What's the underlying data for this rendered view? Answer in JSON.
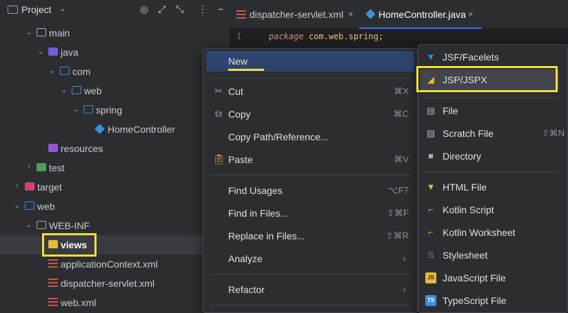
{
  "project_panel": {
    "title": "Project",
    "tree": [
      {
        "label": "main",
        "icon": "folder-icon"
      },
      {
        "label": "java",
        "icon": "source-folder-icon"
      },
      {
        "label": "com",
        "icon": "package-icon"
      },
      {
        "label": "web",
        "icon": "package-icon"
      },
      {
        "label": "spring",
        "icon": "package-icon"
      },
      {
        "label": "HomeController",
        "icon": "java-class-icon"
      },
      {
        "label": "resources",
        "icon": "resources-folder-icon"
      },
      {
        "label": "test",
        "icon": "test-folder-icon"
      },
      {
        "label": "target",
        "icon": "excluded-folder-icon"
      },
      {
        "label": "web",
        "icon": "web-folder-icon"
      },
      {
        "label": "WEB-INF",
        "icon": "folder-icon"
      },
      {
        "label": "views",
        "icon": "folder-icon"
      },
      {
        "label": "applicationContext.xml",
        "icon": "xml-file-icon"
      },
      {
        "label": "dispatcher-servlet.xml",
        "icon": "xml-file-icon"
      },
      {
        "label": "web.xml",
        "icon": "xml-file-icon"
      }
    ]
  },
  "tabs": [
    {
      "label": "dispatcher-servlet.xml",
      "icon": "xml-file-icon"
    },
    {
      "label": "HomeController.java",
      "icon": "java-class-icon",
      "active": true
    }
  ],
  "editor": {
    "line_number": "1",
    "keyword": "package",
    "package_name": "com.web.spring;"
  },
  "context_menu": {
    "items": [
      {
        "label": "New",
        "shortcut": "",
        "submenu": true
      },
      {
        "label": "Cut",
        "shortcut": "⌘X",
        "icon": "scissors-icon"
      },
      {
        "label": "Copy",
        "shortcut": "⌘C",
        "icon": "copy-icon"
      },
      {
        "label": "Copy Path/Reference...",
        "shortcut": ""
      },
      {
        "label": "Paste",
        "shortcut": "⌘V",
        "icon": "clipboard-icon"
      },
      {
        "label": "Find Usages",
        "shortcut": "⌥F7"
      },
      {
        "label": "Find in Files...",
        "shortcut": "⇧⌘F"
      },
      {
        "label": "Replace in Files...",
        "shortcut": "⇧⌘R"
      },
      {
        "label": "Analyze",
        "shortcut": "",
        "submenu": true
      },
      {
        "label": "Refactor",
        "shortcut": "",
        "submenu": true
      }
    ],
    "submenu_arrow": "›"
  },
  "new_submenu": {
    "items": [
      {
        "label": "JSF/Facelets",
        "icon": "html5-icon",
        "color": "#3d8fd8"
      },
      {
        "label": "JSP/JSPX",
        "icon": "jsp-icon",
        "color": "#e6b93a"
      },
      {
        "label": "File",
        "icon": "file-icon",
        "color": "#a8abb2"
      },
      {
        "label": "Scratch File",
        "shortcut": "⇧⌘N",
        "icon": "scratch-file-icon",
        "color": "#a8abb2"
      },
      {
        "label": "Directory",
        "icon": "folder-icon",
        "color": "#a8abb2"
      },
      {
        "label": "HTML File",
        "icon": "html5-icon",
        "color": "#e6b93a"
      },
      {
        "label": "Kotlin Script",
        "icon": "kotlin-script-icon",
        "color": "#e6b93a"
      },
      {
        "label": "Kotlin Worksheet",
        "icon": "kotlin-worksheet-icon",
        "color": "#e6b93a"
      },
      {
        "label": "Stylesheet",
        "icon": "css-icon",
        "color": "#3d8fd8"
      },
      {
        "label": "JavaScript File",
        "icon": "javascript-icon",
        "color": "#e6b93a"
      },
      {
        "label": "TypeScript File",
        "icon": "typescript-icon",
        "color": "#3d8fd8"
      }
    ]
  },
  "colors": {
    "highlight": "#f2e03c",
    "menu_active": "#2e436e",
    "tab_accent": "#3574f0"
  }
}
